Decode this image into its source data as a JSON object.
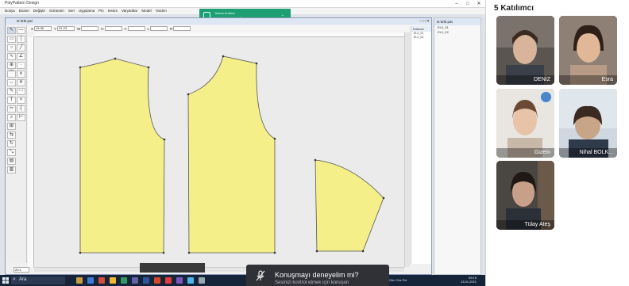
{
  "app": {
    "title": "PolyPattern Design",
    "menus": [
      "Dosya",
      "Düzen",
      "Değiştir",
      "Görünüm",
      "Seri",
      "Uygulama",
      "Pin",
      "Kesim",
      "Varyantlar",
      "Model",
      "Yardım"
    ],
    "document_name": "D:\\El0.pat",
    "coords": [
      {
        "label": "X",
        "value": "43.96"
      },
      {
        "label": "Y",
        "value": "91.23"
      },
      {
        "label": "W",
        "value": ""
      },
      {
        "label": "H",
        "value": ""
      },
      {
        "label": "A",
        "value": ""
      },
      {
        "label": "L",
        "value": ""
      },
      {
        "label": "R",
        "value": ""
      }
    ],
    "zoom": "20.1",
    "layers_title": "Katman",
    "layers": [
      "EL0_01",
      "EL0_02"
    ],
    "right_panel_title": "D:\\El0.pat",
    "right_panel_items": [
      "EL0_01",
      "EL0_02"
    ]
  },
  "notification": {
    "line1": "Teams Anlatıcı",
    "line2": "web konferansı kullanıyor"
  },
  "toast": {
    "title": "Konuşmayı deneyelim mi?",
    "subtitle": "Sesinizi kontrol etmek için konuşun"
  },
  "taskbar": {
    "search_placeholder": "Ara",
    "tray_text": "Gün Yüz Pct",
    "time": "09:15",
    "date": "13.01.2021"
  },
  "participants": {
    "title": "5 Katılımcı",
    "list": [
      {
        "name": "DENİZ"
      },
      {
        "name": "Esra"
      },
      {
        "name": "Gizem"
      },
      {
        "name": "Nihal BOLK..."
      },
      {
        "name": "Tülay Ateş"
      }
    ]
  },
  "colors": {
    "pattern_fill": "#f5ef8a",
    "pattern_stroke": "#555555",
    "taskbar": "#16243a",
    "notify": "#1e9e73",
    "toast": "#2f3136"
  }
}
